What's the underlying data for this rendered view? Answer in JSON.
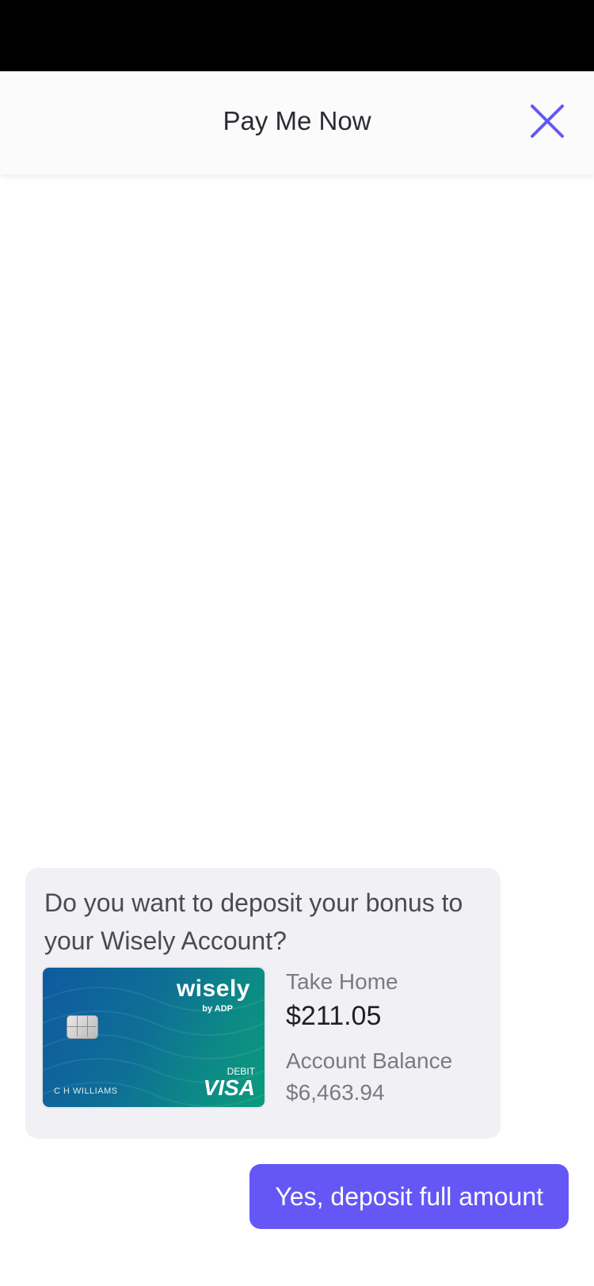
{
  "header": {
    "title": "Pay Me Now",
    "close_icon": "close-icon",
    "accent_color": "#6457F6"
  },
  "bot_message": {
    "question": "Do you want to deposit your bonus to your Wisely Account?",
    "card": {
      "brand_logo": "wisely",
      "brand_logo_sub": "by ADP",
      "type": "DEBIT",
      "network": "VISA",
      "holder_name": "C H WILLIAMS"
    },
    "take_home_label": "Take Home",
    "take_home_value": "$211.05",
    "balance_label": "Account Balance",
    "balance_value": "$6,463.94"
  },
  "user_reply": {
    "label": "Yes, deposit full amount",
    "color": "#6457F6"
  }
}
